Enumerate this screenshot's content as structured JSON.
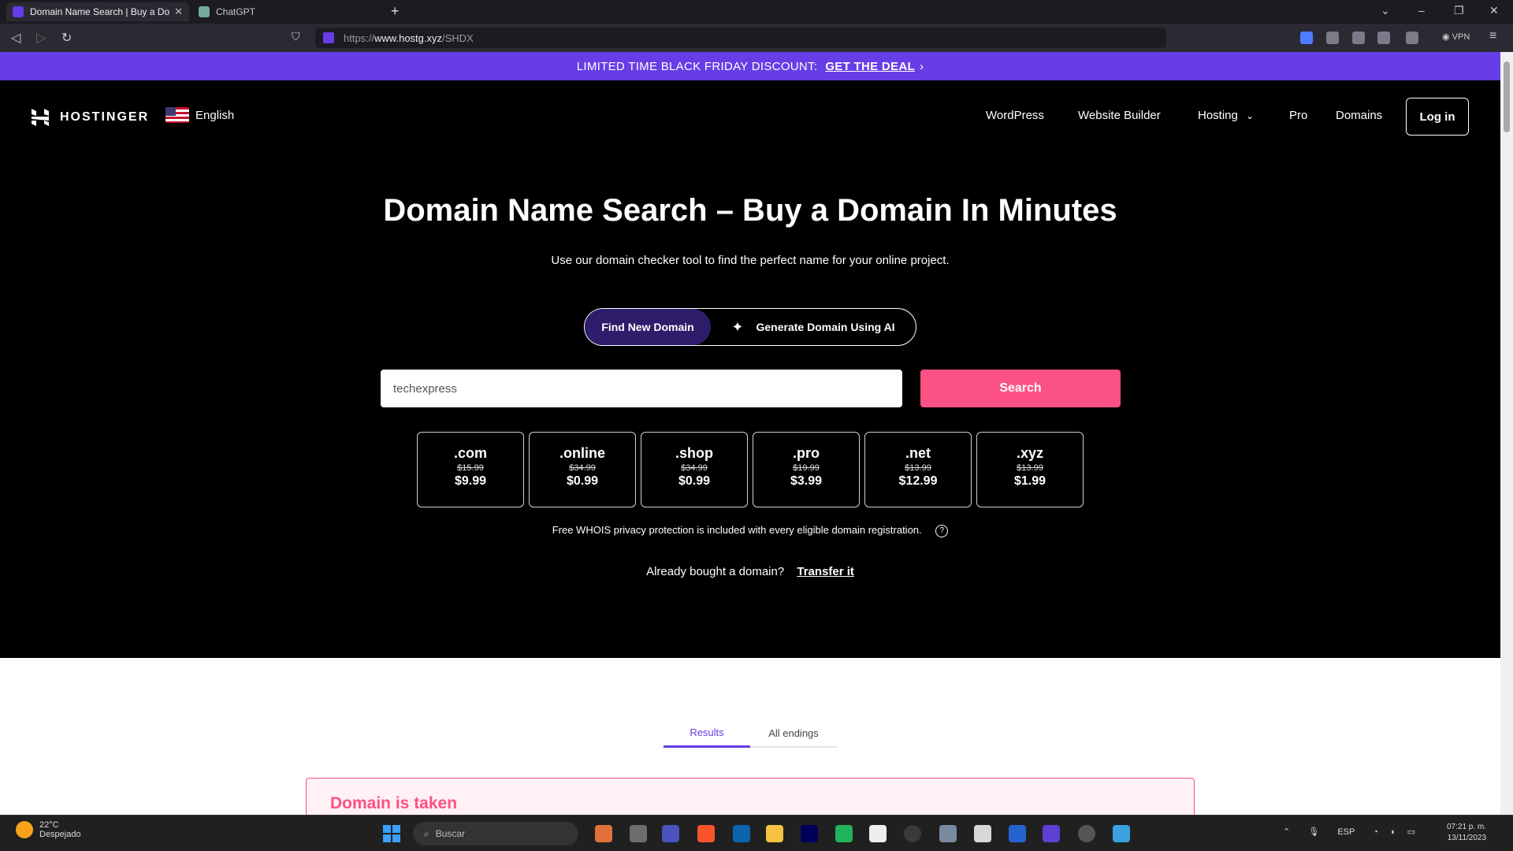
{
  "browser": {
    "tabs": [
      {
        "title": "Domain Name Search | Buy a Do",
        "active": true
      },
      {
        "title": "ChatGPT",
        "active": false
      }
    ],
    "url_prefix": "https://",
    "url_host": "www.hostg.xyz",
    "url_path": "/SHDX",
    "vpn_label": "VPN"
  },
  "promo": {
    "text": "LIMITED TIME BLACK FRIDAY DISCOUNT:",
    "link": "GET THE DEAL",
    "arrow": "›",
    "color": "#673de6"
  },
  "header": {
    "logo": "HOSTINGER",
    "language": "English",
    "menu": [
      "WordPress",
      "Website Builder",
      "Hosting",
      "Pro",
      "Domains"
    ],
    "login": "Log in"
  },
  "hero": {
    "title": "Domain Name Search – Buy a Domain In Minutes",
    "subtitle": "Use our domain checker tool to find the perfect name for your online project.",
    "toggle": {
      "find": "Find New Domain",
      "ai": "Generate Domain Using AI"
    },
    "search_value": "techexpress",
    "search_button": "Search",
    "search_color": "#fc5185"
  },
  "tlds": [
    {
      "name": ".com",
      "old": "$15.99",
      "new": "$9.99"
    },
    {
      "name": ".online",
      "old": "$34.99",
      "new": "$0.99"
    },
    {
      "name": ".shop",
      "old": "$34.99",
      "new": "$0.99"
    },
    {
      "name": ".pro",
      "old": "$19.99",
      "new": "$3.99"
    },
    {
      "name": ".net",
      "old": "$13.99",
      "new": "$12.99"
    },
    {
      "name": ".xyz",
      "old": "$13.99",
      "new": "$1.99"
    }
  ],
  "whois": "Free WHOIS privacy protection is included with every eligible domain registration.",
  "transfer": {
    "text": "Already bought a domain?",
    "link": "Transfer it"
  },
  "results": {
    "tabs": [
      "Results",
      "All endings"
    ],
    "taken": "Domain is taken"
  },
  "taskbar": {
    "temp": "22°C",
    "weather": "Despejado",
    "search": "Buscar",
    "lang": "ESP",
    "time": "07:21 p. m.",
    "date": "13/11/2023"
  }
}
